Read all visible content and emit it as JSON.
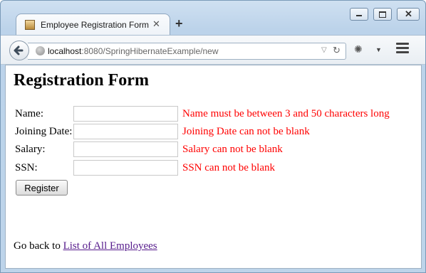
{
  "browser": {
    "tab": {
      "title": "Employee Registration Form"
    },
    "address": {
      "host": "localhost",
      "path": ":8080/SpringHibernateExample/new"
    }
  },
  "page": {
    "title": "Registration Form",
    "fields": [
      {
        "label": "Name:",
        "value": "",
        "error": "Name must be between 3 and 50 characters long"
      },
      {
        "label": "Joining Date:",
        "value": "",
        "error": "Joining Date can not be blank"
      },
      {
        "label": "Salary:",
        "value": "",
        "error": "Salary can not be blank"
      },
      {
        "label": "SSN:",
        "value": "",
        "error": "SSN can not be blank"
      }
    ],
    "register_label": "Register",
    "back_prefix": "Go back to",
    "back_link": "List of All Employees",
    "colors": {
      "error": "#ff0000",
      "link_visited": "#551a8b"
    }
  }
}
